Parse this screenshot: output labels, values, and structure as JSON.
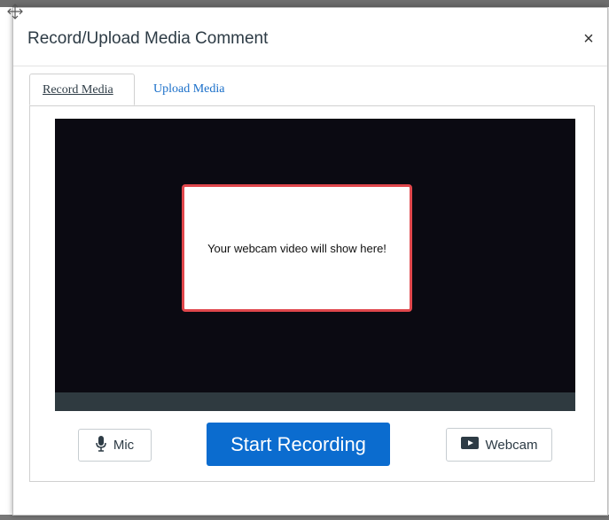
{
  "dialog": {
    "title": "Record/Upload Media Comment",
    "close_label": "×"
  },
  "tabs": [
    {
      "label": "Record Media",
      "active": true
    },
    {
      "label": "Upload Media",
      "active": false
    }
  ],
  "video": {
    "placeholder_text": "Your webcam video will show here!"
  },
  "controls": {
    "mic_label": "Mic",
    "start_label": "Start Recording",
    "webcam_label": "Webcam"
  },
  "colors": {
    "primary": "#0b6ccf",
    "link": "#1a6fc9",
    "placeholder_border": "#e0474c",
    "video_bg": "#0b0a12"
  },
  "icons": {
    "move": "move-icon",
    "close": "close-icon",
    "mic": "microphone-icon",
    "webcam": "play-icon"
  }
}
